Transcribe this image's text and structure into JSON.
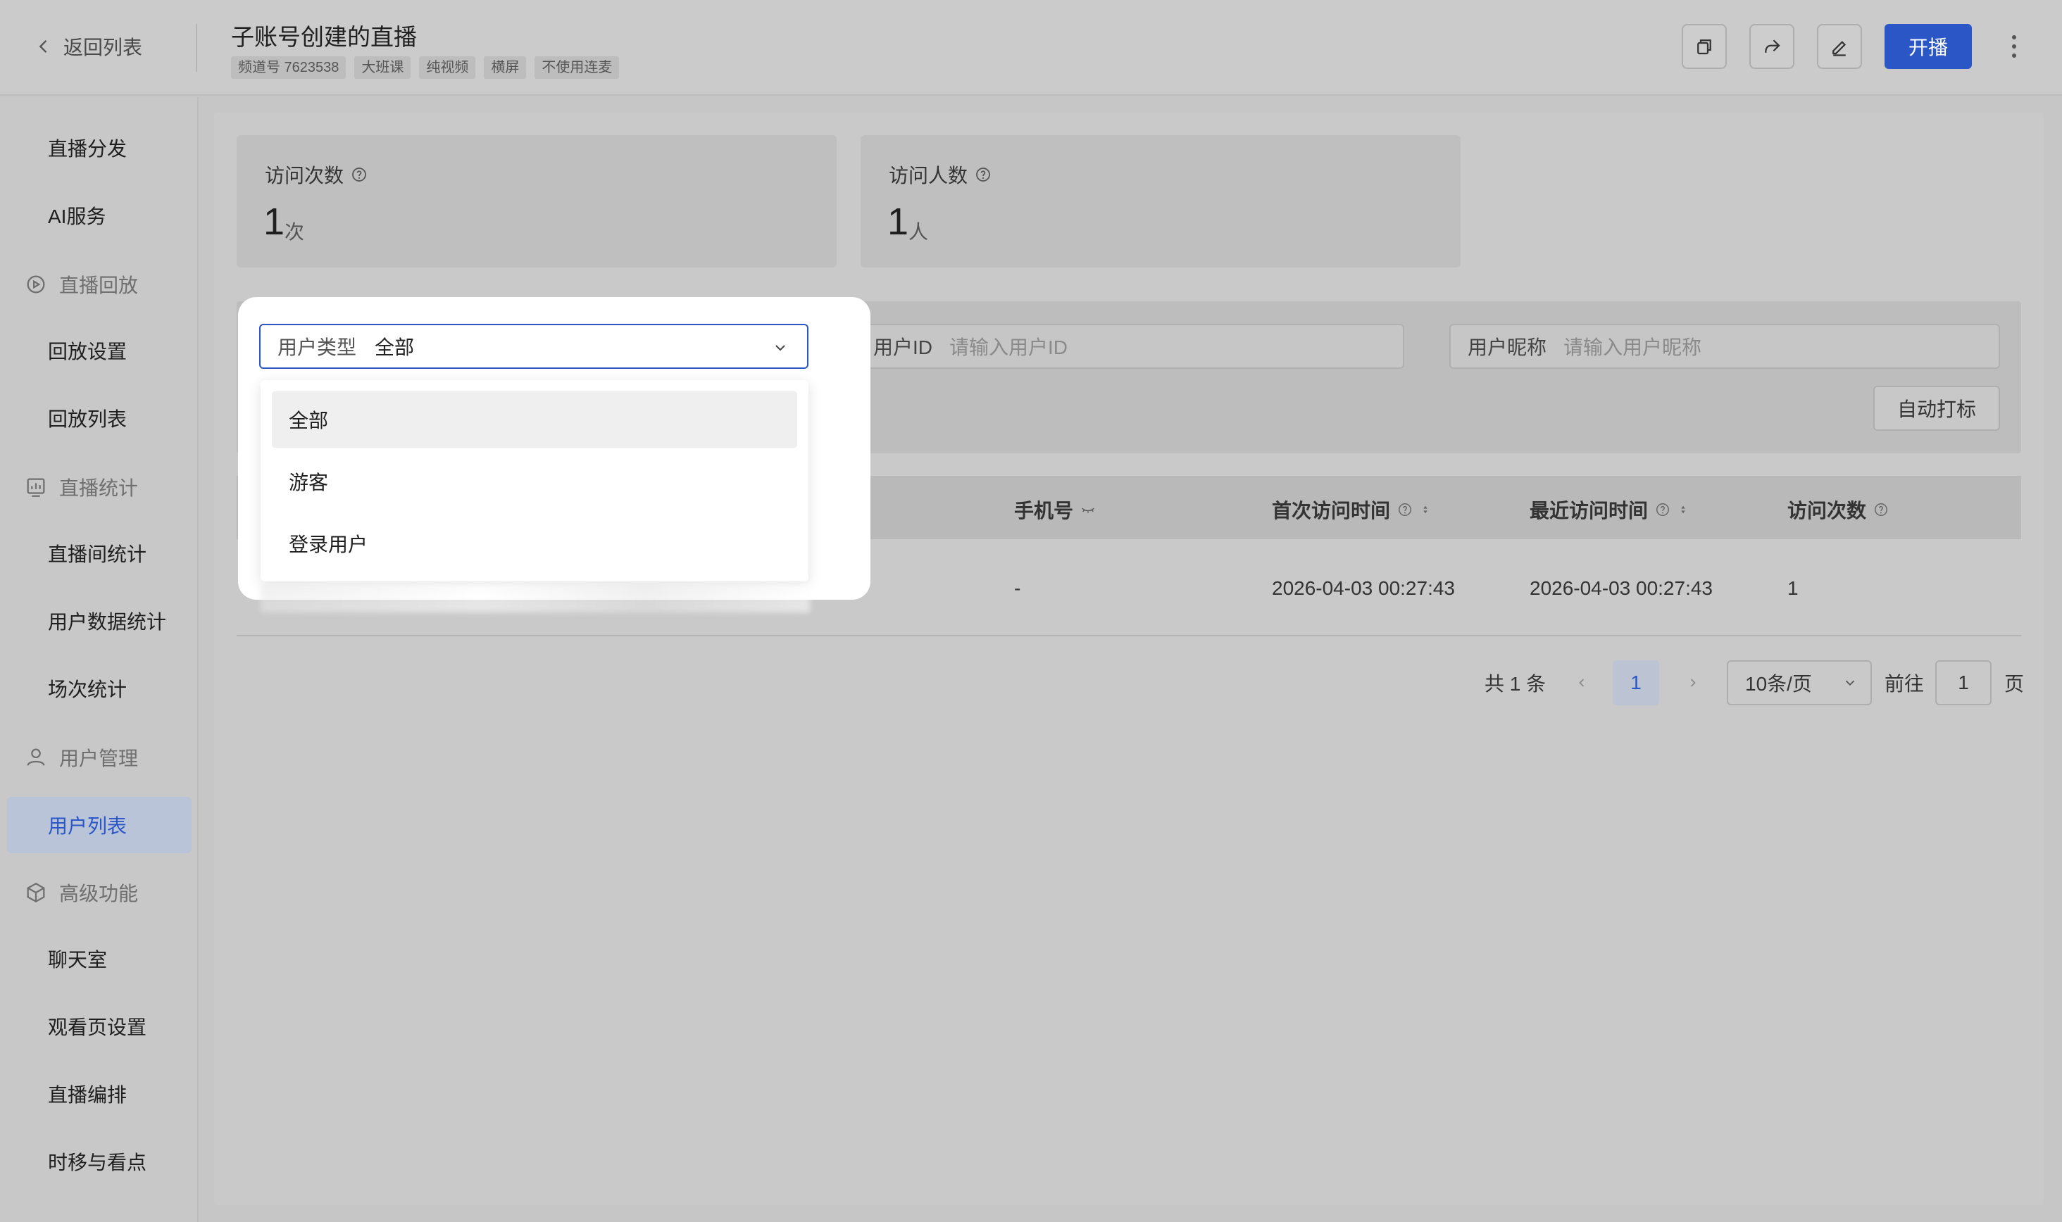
{
  "header": {
    "back_label": "返回列表",
    "title": "子账号创建的直播",
    "tags": [
      "频道号 7623538",
      "大班课",
      "纯视频",
      "横屏",
      "不使用连麦"
    ],
    "start_label": "开播"
  },
  "sidebar": {
    "items": [
      {
        "label": "直播分发",
        "type": "item"
      },
      {
        "label": "AI服务",
        "type": "item"
      },
      {
        "label": "直播回放",
        "type": "group",
        "icon": "replay-icon"
      },
      {
        "label": "回放设置",
        "type": "item"
      },
      {
        "label": "回放列表",
        "type": "item"
      },
      {
        "label": "直播统计",
        "type": "group",
        "icon": "chart-icon"
      },
      {
        "label": "直播间统计",
        "type": "item"
      },
      {
        "label": "用户数据统计",
        "type": "item"
      },
      {
        "label": "场次统计",
        "type": "item"
      },
      {
        "label": "用户管理",
        "type": "group",
        "icon": "user-icon"
      },
      {
        "label": "用户列表",
        "type": "item",
        "active": true
      },
      {
        "label": "高级功能",
        "type": "group",
        "icon": "cube-icon"
      },
      {
        "label": "聊天室",
        "type": "item"
      },
      {
        "label": "观看页设置",
        "type": "item"
      },
      {
        "label": "直播编排",
        "type": "item"
      },
      {
        "label": "时移与看点",
        "type": "item"
      }
    ]
  },
  "stats": {
    "visits": {
      "label": "访问次数",
      "value": "1",
      "unit": "次"
    },
    "visitors": {
      "label": "访问人数",
      "value": "1",
      "unit": "人"
    }
  },
  "filters": {
    "user_type": {
      "label": "用户类型",
      "value": "全部",
      "options": [
        "全部",
        "游客",
        "登录用户"
      ]
    },
    "user_id": {
      "label": "用户ID",
      "placeholder": "请输入用户ID"
    },
    "nickname": {
      "label": "用户昵称",
      "placeholder": "请输入用户昵称"
    },
    "auto_tag_label": "自动打标"
  },
  "table": {
    "columns": [
      "手机号",
      "首次访问时间",
      "最近访问时间",
      "访问次数"
    ],
    "rows": [
      {
        "phone": "-",
        "first_visit": "2026-04-03 00:27:43",
        "last_visit": "2026-04-03 00:27:43",
        "visits": "1"
      }
    ]
  },
  "pagination": {
    "total": "共 1 条",
    "current_page": "1",
    "page_size": "10条/页",
    "goto_prefix": "前往",
    "goto_value": "1",
    "goto_suffix": "页"
  },
  "colors": {
    "accent": "#2a56c6",
    "overlay": "#c6c6c6"
  }
}
